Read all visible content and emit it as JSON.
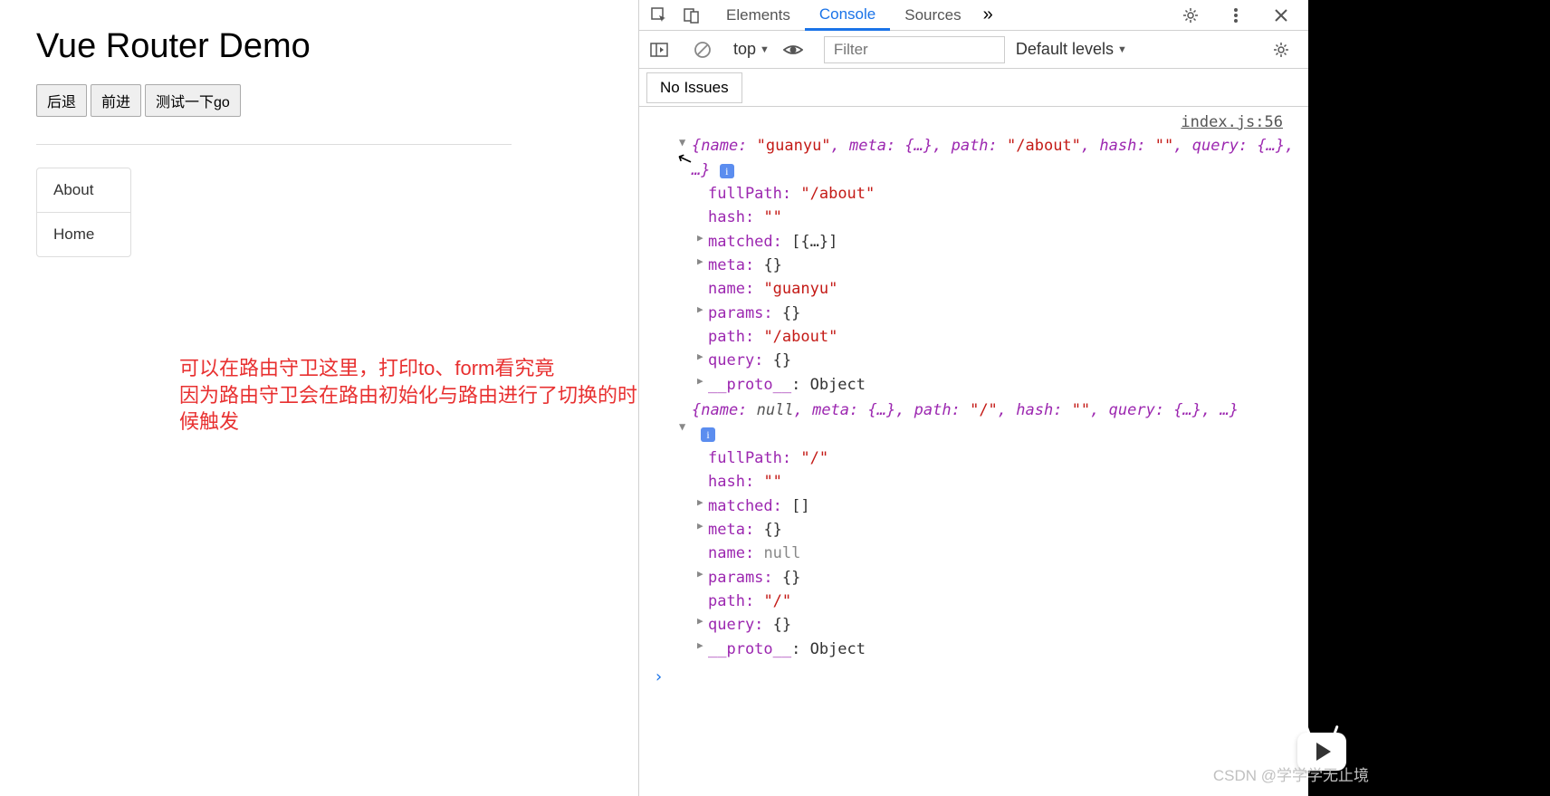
{
  "page": {
    "title": "Vue Router Demo",
    "buttons": {
      "back": "后退",
      "forward": "前进",
      "test_go": "测试一下go"
    },
    "nav": {
      "about": "About",
      "home": "Home"
    },
    "annotation": {
      "line1": "可以在路由守卫这里，打印to、form看究竟",
      "line2": "因为路由守卫会在路由初始化与路由进行了切换的时候触发"
    }
  },
  "devtools": {
    "tabs": {
      "elements": "Elements",
      "console": "Console",
      "sources": "Sources",
      "more": "»"
    },
    "toolbar": {
      "context": "top",
      "filter_placeholder": "Filter",
      "levels": "Default levels"
    },
    "issues": "No Issues",
    "source_link": "index.js:56",
    "obj1": {
      "summary_pre": "{name: ",
      "summary_name": "\"guanyu\"",
      "summary_mid1": ", meta: {…}, path: ",
      "summary_path": "\"/about\"",
      "summary_mid2": ", hash: ",
      "summary_hash": "\"\"",
      "summary_mid3": ", query: {…}, …}",
      "props": {
        "fullPath_k": "fullPath:",
        "fullPath_v": "\"/about\"",
        "hash_k": "hash:",
        "hash_v": "\"\"",
        "matched_k": "matched:",
        "matched_v": "[{…}]",
        "meta_k": "meta:",
        "meta_v": "{}",
        "name_k": "name:",
        "name_v": "\"guanyu\"",
        "params_k": "params:",
        "params_v": "{}",
        "path_k": "path:",
        "path_v": "\"/about\"",
        "query_k": "query:",
        "query_v": "{}",
        "proto_k": "__proto__",
        "proto_v": ": Object"
      }
    },
    "obj2": {
      "summary_pre": "{name: ",
      "summary_name": "null",
      "summary_mid1": ", meta: {…}, path: ",
      "summary_path": "\"/\"",
      "summary_mid2": ", hash: ",
      "summary_hash": "\"\"",
      "summary_mid3": ", query: {…}, …}",
      "props": {
        "fullPath_k": "fullPath:",
        "fullPath_v": "\"/\"",
        "hash_k": "hash:",
        "hash_v": "\"\"",
        "matched_k": "matched:",
        "matched_v": "[]",
        "meta_k": "meta:",
        "meta_v": "{}",
        "name_k": "name:",
        "name_v": "null",
        "params_k": "params:",
        "params_v": "{}",
        "path_k": "path:",
        "path_v": "\"/\"",
        "query_k": "query:",
        "query_v": "{}",
        "proto_k": "__proto__",
        "proto_v": ": Object"
      }
    },
    "prompt": "›"
  },
  "watermark": "CSDN @学学学无止境"
}
